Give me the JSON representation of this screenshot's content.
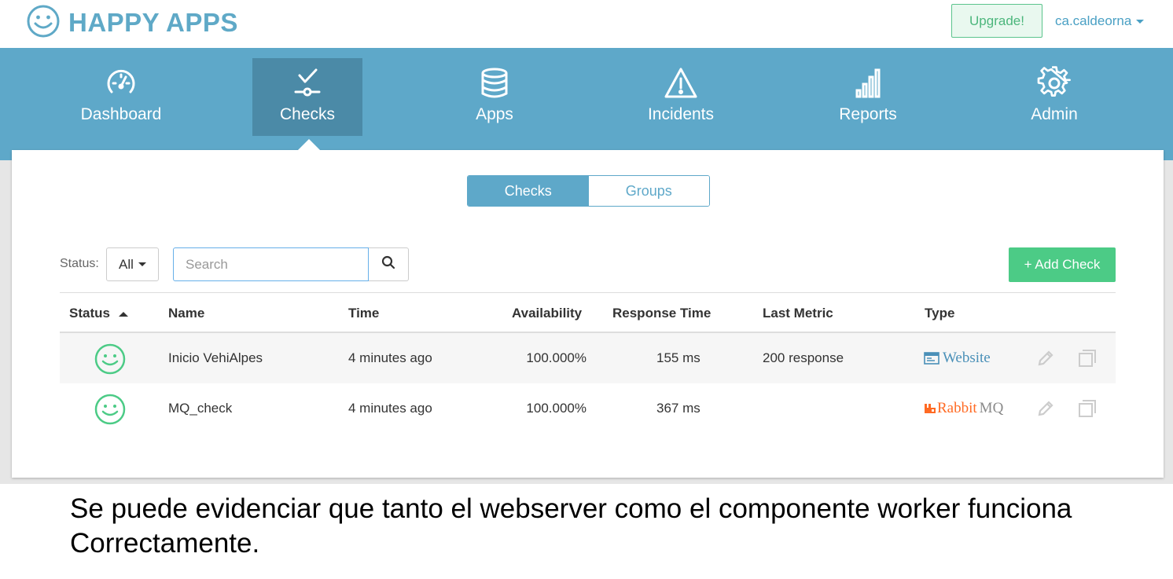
{
  "brand": {
    "name": "HAPPY APPS"
  },
  "topbar": {
    "upgrade_label": "Upgrade!",
    "user_name": "ca.caldeorna"
  },
  "nav": {
    "items": [
      {
        "label": "Dashboard",
        "icon": "gauge-icon"
      },
      {
        "label": "Checks",
        "icon": "checks-icon"
      },
      {
        "label": "Apps",
        "icon": "database-icon"
      },
      {
        "label": "Incidents",
        "icon": "warning-icon"
      },
      {
        "label": "Reports",
        "icon": "bar-chart-icon"
      },
      {
        "label": "Admin",
        "icon": "gear-icon"
      }
    ],
    "active": "Checks"
  },
  "tabs": {
    "checks_label": "Checks",
    "groups_label": "Groups",
    "active": "Checks"
  },
  "filters": {
    "status_label": "Status:",
    "status_value": "All",
    "search_placeholder": "Search",
    "search_value": "",
    "add_label": "+ Add Check"
  },
  "table": {
    "columns": {
      "status": "Status",
      "name": "Name",
      "time": "Time",
      "availability": "Availability",
      "response": "Response Time",
      "last_metric": "Last Metric",
      "type": "Type"
    },
    "rows": [
      {
        "status": "happy",
        "name": "Inicio VehiAlpes",
        "time": "4 minutes ago",
        "availability": "100.000%",
        "response": "155 ms",
        "last_metric": "200 response",
        "type": "Website"
      },
      {
        "status": "happy",
        "name": "MQ_check",
        "time": "4 minutes ago",
        "availability": "100.000%",
        "response": "367 ms",
        "last_metric": "",
        "type_a": "Rabbit",
        "type_b": "MQ"
      }
    ]
  },
  "caption": "Se puede evidenciar que tanto el webserver como el componente worker funciona Correctamente.",
  "colors": {
    "brand": "#5fa9c7",
    "nav_bg": "#5ea8c9",
    "nav_active": "#4b8aa7",
    "success": "#4ccb86",
    "rabbit": "#ff6a23"
  }
}
